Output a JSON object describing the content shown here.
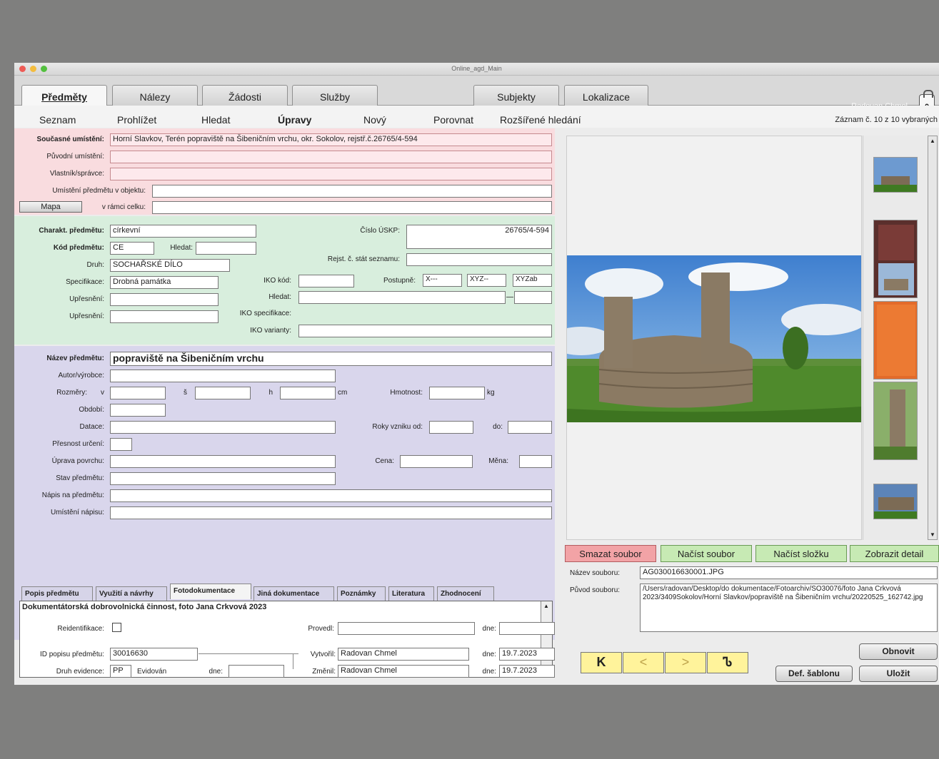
{
  "window": {
    "title": "Online_agd_Main"
  },
  "main_tabs": [
    "Předměty",
    "Nálezy",
    "Žádosti",
    "Služby",
    "Subjekty",
    "Lokalizace"
  ],
  "user": "Radovan Chmel",
  "lock_count": "0",
  "subnav": [
    "Seznam",
    "Prohlížet",
    "Hledat",
    "Úpravy",
    "Nový",
    "Porovnat",
    "Rozšířené hledání"
  ],
  "record_info": "Záznam č. 10 z 10 vybraných",
  "location": {
    "current_label": "Současné umístění:",
    "current_value": "Horní Slavkov, Terén popraviště na Šibeničním vrchu, okr. Sokolov, rejstř.č.26765/4-594",
    "original_label": "Původní umístění:",
    "owner_label": "Vlastník/správce:",
    "in_object_label": "Umístění předmětu v objektu:",
    "map_button": "Mapa",
    "in_whole_label": "v rámci celku:"
  },
  "characteristics": {
    "charakt_label": "Charakt. předmětu:",
    "charakt_value": "církevní",
    "kod_label": "Kód předmětu:",
    "kod_value": "CE",
    "hledat_label": "Hledat:",
    "druh_label": "Druh:",
    "druh_value": "SOCHAŘSKÉ DÍLO",
    "specifikace_label": "Specifikace:",
    "specifikace_value": "Drobná památka",
    "upresneni_label": "Upřesnění:",
    "uskp_label": "Číslo ÚSKP:",
    "uskp_value": "26765/4-594",
    "rejst_label": "Rejst. č. stát seznamu:",
    "iko_kod_label": "IKO kód:",
    "postupne_label": "Postupně:",
    "postupne_values": [
      "X---",
      "XYZ--",
      "XYZab"
    ],
    "iko_spec_label": "IKO specifikace:",
    "iko_var_label": "IKO varianty:"
  },
  "details": {
    "nazev_label": "Název předmětu:",
    "nazev_value": "popraviště na Šibeničním vrchu",
    "autor_label": "Autor/výrobce:",
    "rozmery_label": "Rozměry:",
    "v_label": "v",
    "s_label": "š",
    "h_label": "h",
    "cm_label": "cm",
    "hmotnost_label": "Hmotnost:",
    "kg_label": "kg",
    "obdobi_label": "Období:",
    "datace_label": "Datace:",
    "roky_label": "Roky vzniku od:",
    "do_label": "do:",
    "presnost_label": "Přesnost určení:",
    "uprava_label": "Úprava povrchu:",
    "cena_label": "Cena:",
    "mena_label": "Měna:",
    "stav_label": "Stav předmětu:",
    "napis_label": "Nápis na předmětu:",
    "umisteni_napisu_label": "Umístění nápisu:"
  },
  "inner_tabs": [
    "Popis předmětu",
    "Využití a návrhy",
    "Fotodokumentace",
    "Jiná dokumentace",
    "Poznámky",
    "Literatura",
    "Zhodnocení"
  ],
  "photo_doc_text": "Dokumentátorská dobrovolnická činnost, foto Jana Crkvová 2023",
  "reident_label": "Reidentifikace:",
  "provedl_label": "Provedl:",
  "dne_label": "dne:",
  "footer": {
    "id_label": "ID popisu předmětu:",
    "id_value": "30016630",
    "druh_ev_label": "Druh evidence:",
    "druh_ev_value": "PP",
    "druh_ev_text": "Evidován",
    "vytvoril_label": "Vytvořil:",
    "vytvoril_value": "Radovan Chmel",
    "vytvoril_date": "19.7.2023",
    "zmenil_label": "Změnil:",
    "zmenil_value": "Radovan Chmel",
    "zmenil_date": "19.7.2023"
  },
  "file_buttons": [
    "Smazat soubor",
    "Načíst soubor",
    "Načíst složku",
    "Zobrazit detail"
  ],
  "file": {
    "name_label": "Název souboru:",
    "name_value": "AG030016630001.JPG",
    "origin_label": "Původ souboru:",
    "origin_value": "/Users/radovan/Desktop/do dokumentace/Fotoarchiv/SO30076/foto Jana Crkvová 2023/3409Sokolov/Horní Slavkov/popraviště na Šibeničním vrchu/20220525_162742.jpg"
  },
  "nav_buttons": [
    "K",
    "<",
    ">",
    "Ꮦ"
  ],
  "action_buttons": {
    "obnovit": "Obnovit",
    "def_sablonu": "Def. šablonu",
    "ulozit": "Uložit"
  },
  "colors": {
    "pink_section": "#f9dcdf",
    "green_section": "#d8eedd",
    "lavender_section": "#d9d6ec",
    "delete_button": "#f2a3a6",
    "file_button": "#c7eab4",
    "nav_button": "#fff39b"
  }
}
